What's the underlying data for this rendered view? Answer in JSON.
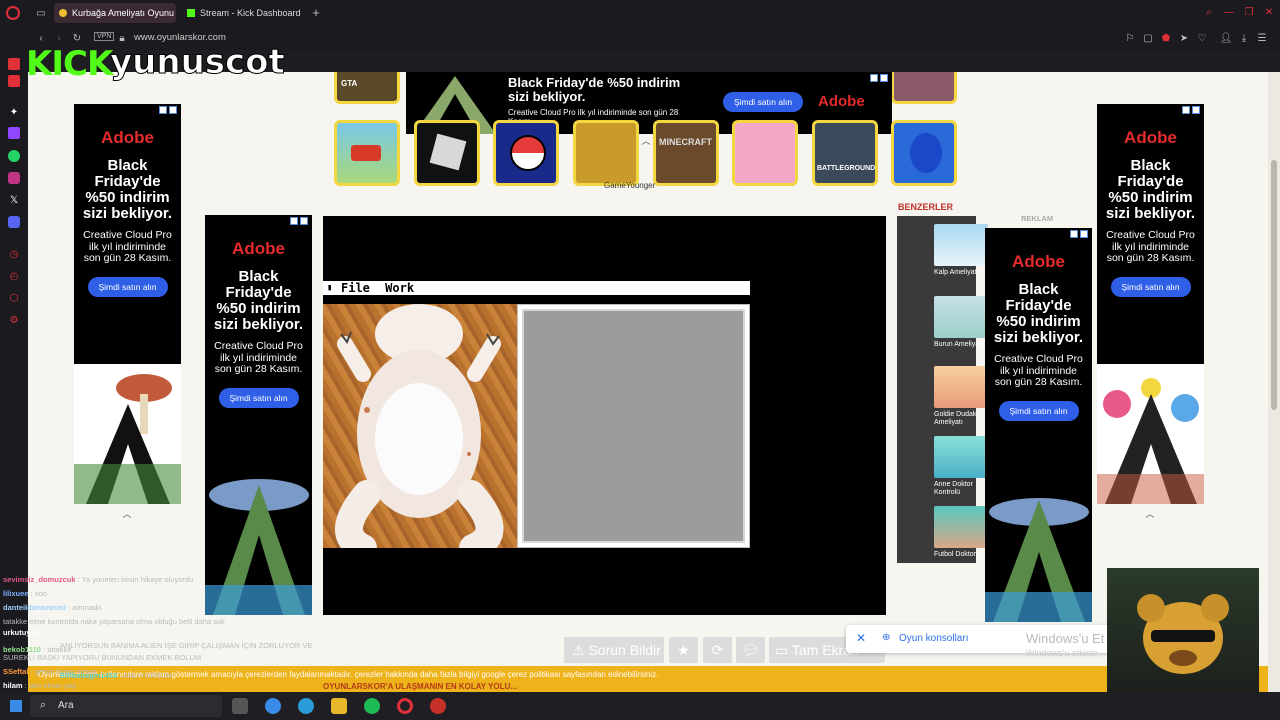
{
  "browser": {
    "tabs": [
      {
        "title": "Kurbağa Ameliyatı Oyunu",
        "active": true
      },
      {
        "title": "Stream - Kick Dashboard",
        "active": false
      }
    ],
    "url": "www.oyunlarskor.com",
    "vpn_label": "VPN"
  },
  "overlay": {
    "brand": "KICK",
    "channel": "yunuscot"
  },
  "top_ad": {
    "headline": "Black Friday'de %50 indirim sizi bekliyor.",
    "subtext": "Creative Cloud Pro ilk yıl indiriminde son gün 28 Kasım.",
    "button": "Şimdi satın alın",
    "brand": "Adobe"
  },
  "side_ad": {
    "brand": "Adobe",
    "headline": "Black Friday'de %50 indirim sizi bekliyor.",
    "subtext": "Creative Cloud Pro ilk yıl indiriminde son gün 28 Kasım.",
    "button": "Şimdi satın alın"
  },
  "ad_attribution": "GameYounger",
  "game": {
    "menu_file": "File",
    "menu_work": "Work"
  },
  "similar": {
    "heading": "BENZERLER",
    "items": [
      "Kalp Ameliyatı",
      "Burun Ameliyatı",
      "Goldie Dudak Ameliyatı",
      "Anne Doktor Kontrolü",
      "Futbol Doktoru"
    ]
  },
  "reklam_label": "REKLAM",
  "actions": {
    "report": "Sorun Bildir",
    "fullscreen": "Tam Ekran"
  },
  "notification": {
    "label": "Oyun konsolları"
  },
  "windows_watermark": {
    "line1": "Windows'u Et",
    "line2": "Windows'u etkinle"
  },
  "cookie_banner": {
    "text": "Oyunlarskor.com kullanıcılara reklam göstermek amacıyla çerezlerden faydalanmaktadır. çerezler hakkında daha fazla bilgiyi google çerez politikası sayfasından edinebilirsiniz.",
    "footer": "OYUNLARSKOR'A ULAŞMANIN EN KOLAY YOLU..."
  },
  "chat": [
    {
      "user": "sevimsiz_domuzcuk",
      "msg": "Ya yoneten kesin hikaye oluyordu",
      "color": "#e05a8a"
    },
    {
      "user": "lilixuee",
      "msg": "ooo",
      "color": "#7ab0ff"
    },
    {
      "user": "danteildonsevcisi",
      "msg": "ammadn",
      "color": "#9ad1ff"
    },
    {
      "user": "",
      "msg": "tatakke elme kontrolda naka yaparsana olma olduğu belli daha sok",
      "color": "#bbb"
    },
    {
      "user": "urkutuyor",
      "msg": "",
      "color": "#fff"
    },
    {
      "user": "bekob1110",
      "msg": "tatakke",
      "color": "#8ee08e"
    },
    {
      "user": "",
      "msg": "ANLIYORSUN BANIMA ALIEN İŞE GİRİP ÇALIŞMAN İÇİN ZORLUYOR VE",
      "color": "#bbb"
    },
    {
      "user": "",
      "msg": "SUREKLI BASKI YAPIYORU BUNUNDAN EKMEK BOLUM",
      "color": "#bbb"
    },
    {
      "user": "SSeftal",
      "msg": "gelsin bizim mesaj",
      "color": "#ff9a3a"
    },
    {
      "user": "Elifbabagm1453",
      "msg": "ANLIYORSUN",
      "color": "#5ad1c8"
    },
    {
      "user": "hilam",
      "msg": "tam ekran yap",
      "color": "#fff"
    },
    {
      "user": "sevimsiz_domuzcuk",
      "msg": "?",
      "color": "#e05a8a"
    }
  ],
  "taskbar": {
    "search_label": "Ara"
  }
}
